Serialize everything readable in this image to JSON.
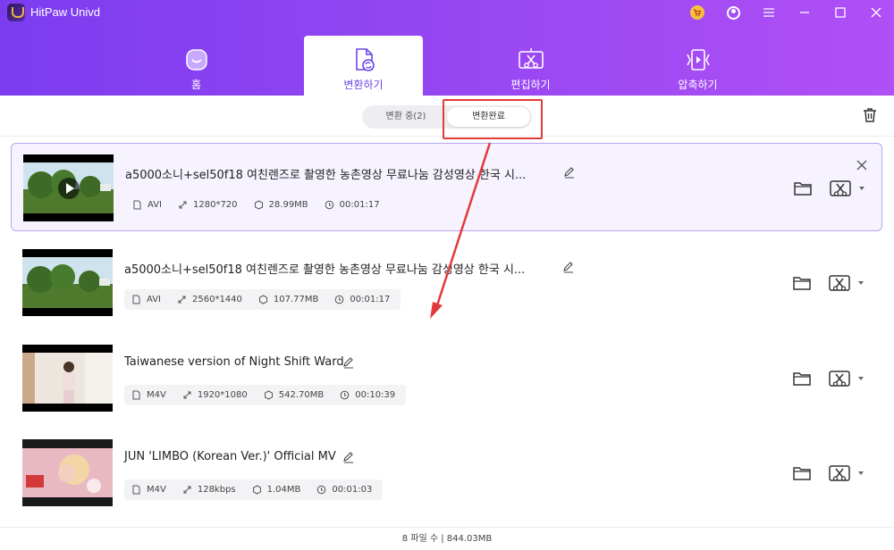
{
  "app": {
    "title": "HitPaw Univd"
  },
  "nav": {
    "tabs": [
      {
        "label": "홈",
        "icon": "home-icon",
        "active": false
      },
      {
        "label": "변환하기",
        "icon": "convert-icon",
        "active": true
      },
      {
        "label": "편집하기",
        "icon": "edit-icon",
        "active": false
      },
      {
        "label": "압축하기",
        "icon": "compress-icon",
        "active": false
      }
    ]
  },
  "subtabs": [
    {
      "label": "변환 중(2)",
      "active": false
    },
    {
      "label": "변환완료",
      "active": true
    }
  ],
  "files": [
    {
      "name": "a5000소니+sel50f18 여친렌즈로 촬영한 농촌영상 무료나눔 감성영상 한국 시...",
      "format": "AVI",
      "resolution": "1280*720",
      "size": "28.99MB",
      "duration": "00:01:17",
      "selected": true
    },
    {
      "name": "a5000소니+sel50f18 여친렌즈로 촬영한 농촌영상 무료나눔 감성영상 한국 시...",
      "format": "AVI",
      "resolution": "2560*1440",
      "size": "107.77MB",
      "duration": "00:01:17",
      "selected": false
    },
    {
      "name": "Taiwanese version of Night Shift Ward",
      "format": "M4V",
      "resolution": "1920*1080",
      "size": "542.70MB",
      "duration": "00:10:39",
      "selected": false
    },
    {
      "name": "JUN 'LIMBO (Korean Ver.)' Official MV",
      "format": "M4V",
      "resolution": "128kbps",
      "size": "1.04MB",
      "duration": "00:01:03",
      "selected": false
    }
  ],
  "footer": {
    "summary": "8 파일 수 | 844.03MB"
  },
  "colors": {
    "header_start": "#7b3cf0",
    "header_end": "#b04ff6",
    "accent": "#6a46e6",
    "annotation": "#e23a3a"
  }
}
